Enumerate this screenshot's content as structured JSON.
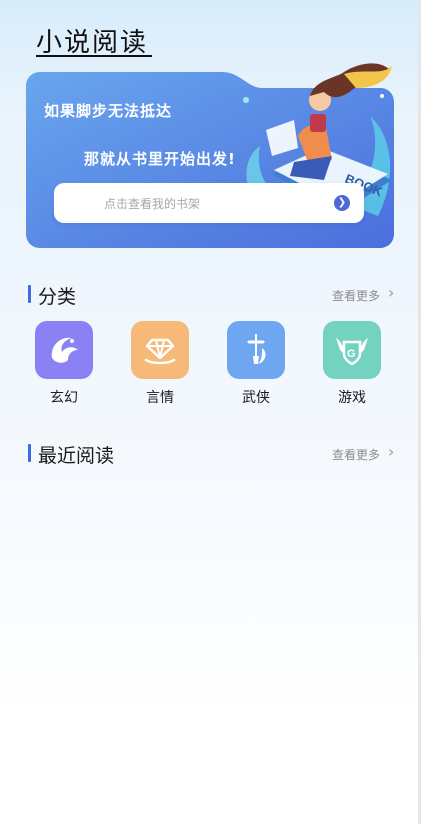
{
  "app": {
    "title": "小说阅读"
  },
  "banner": {
    "line1": "如果脚步无法抵达",
    "line2": "那就从书里开始出发!",
    "shelf_button": "点击查看我的书架",
    "book_text": "BOOK"
  },
  "categories_section": {
    "title": "分类",
    "more": "查看更多",
    "items": [
      {
        "label": "玄幻",
        "color": "#8a82f4",
        "icon": "phoenix-icon"
      },
      {
        "label": "言情",
        "color": "#f7b978",
        "icon": "diamond-ring-icon"
      },
      {
        "label": "武侠",
        "color": "#6fa6f2",
        "icon": "sword-icon"
      },
      {
        "label": "游戏",
        "color": "#73d3c0",
        "icon": "game-badge-icon"
      }
    ]
  },
  "recent_section": {
    "title": "最近阅读",
    "more": "查看更多"
  },
  "colors": {
    "accent": "#3f6be0",
    "banner_start": "#5b8fe8",
    "banner_end": "#4a6fdc"
  }
}
